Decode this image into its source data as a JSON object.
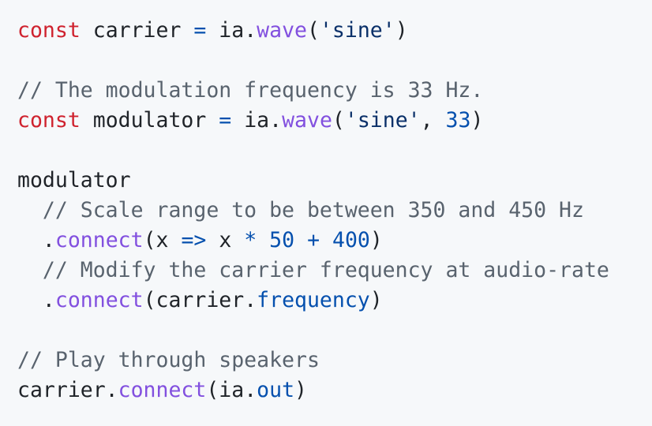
{
  "code": {
    "line1": {
      "kw": "const",
      "name": " carrier ",
      "eq": "=",
      "obj": " ia.",
      "fn": "wave",
      "open": "(",
      "str": "'sine'",
      "close": ")"
    },
    "line3": {
      "comment": "// The modulation frequency is 33 Hz."
    },
    "line4": {
      "kw": "const",
      "name": " modulator ",
      "eq": "=",
      "obj": " ia.",
      "fn": "wave",
      "open": "(",
      "str": "'sine'",
      "comma": ", ",
      "num": "33",
      "close": ")"
    },
    "line6": {
      "name": "modulator"
    },
    "line7": {
      "comment": "  // Scale range to be between 350 and 450 Hz"
    },
    "line8": {
      "indent": "  .",
      "fn": "connect",
      "open": "(x ",
      "arrow": "=>",
      "mid": " x ",
      "mul": "*",
      "sp1": " ",
      "n1": "50",
      "sp2": " ",
      "plus": "+",
      "sp3": " ",
      "n2": "400",
      "close": ")"
    },
    "line9": {
      "comment": "  // Modify the carrier frequency at audio-rate"
    },
    "line10": {
      "indent": "  .",
      "fn": "connect",
      "open": "(carrier.",
      "prop": "frequency",
      "close": ")"
    },
    "line12": {
      "comment": "// Play through speakers"
    },
    "line13": {
      "obj": "carrier.",
      "fn": "connect",
      "open": "(ia.",
      "prop": "out",
      "close": ")"
    }
  }
}
